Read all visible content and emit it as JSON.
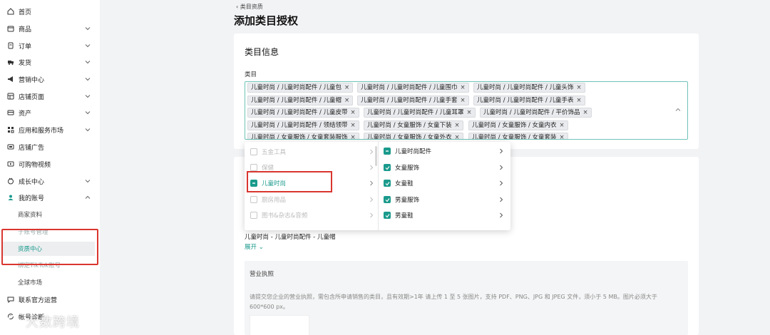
{
  "sidebar": {
    "items": [
      {
        "label": "首页",
        "icon": "home-icon"
      },
      {
        "label": "商品",
        "icon": "product-icon"
      },
      {
        "label": "订单",
        "icon": "order-icon"
      },
      {
        "label": "发货",
        "icon": "truck-icon"
      },
      {
        "label": "营销中心",
        "icon": "megaphone-icon"
      },
      {
        "label": "店铺页面",
        "icon": "store-page-icon"
      },
      {
        "label": "资产",
        "icon": "wallet-icon"
      },
      {
        "label": "应用和服务市场",
        "icon": "apps-icon"
      },
      {
        "label": "店铺广告",
        "icon": "ad-icon"
      },
      {
        "label": "可购物视频",
        "icon": "video-icon"
      },
      {
        "label": "成长中心",
        "icon": "growth-icon"
      },
      {
        "label": "我的账号",
        "icon": "user-icon"
      }
    ],
    "sub_items": [
      "商家资料",
      "子账号管理",
      "资质中心",
      "绑定TikTok账号",
      "全球市场"
    ],
    "bottom_items": [
      {
        "label": "联系官方运营",
        "icon": "chat-icon"
      },
      {
        "label": "帐号诊断",
        "icon": "diagnosis-icon"
      }
    ]
  },
  "breadcrumb": "类目资质",
  "page_title": "添加类目授权",
  "category_card": {
    "heading": "类目信息",
    "field_label": "类目",
    "tags": [
      "儿童时尚 / 儿童时尚配件 / 儿童包",
      "儿童时尚 / 儿童时尚配件 / 儿童围巾",
      "儿童时尚 / 儿童时尚配件 / 儿童头饰",
      "儿童时尚 / 儿童时尚配件 / 儿童帽",
      "儿童时尚 / 儿童时尚配件 / 儿童手套",
      "儿童时尚 / 儿童时尚配件 / 儿童手表",
      "儿童时尚 / 儿童时尚配件 / 儿童皮带",
      "儿童时尚 / 儿童时尚配件 / 儿童耳罩",
      "儿童时尚 / 儿童时尚配件 / 平价饰品",
      "儿童时尚 / 儿童时尚配件 / 领结领带",
      "儿童时尚 / 女童服饰 / 女童下装",
      "儿童时尚 / 女童服饰 / 女童内衣",
      "儿童时尚 / 女童服饰 / 女童套装服饰",
      "儿童时尚 / 女童服饰 / 女童外衣",
      "儿童时尚 / 女童服饰 / 女童套装"
    ]
  },
  "dropdown": {
    "left_options": [
      {
        "label": "五金工具",
        "state": "disabled"
      },
      {
        "label": "保健",
        "state": "disabled"
      },
      {
        "label": "儿童时尚",
        "state": "partial"
      },
      {
        "label": "厨房用品",
        "state": "disabled"
      },
      {
        "label": "图书&杂志&音频",
        "state": "disabled"
      }
    ],
    "right_options": [
      {
        "label": "儿童时尚配件",
        "state": "partial"
      },
      {
        "label": "女童服饰",
        "state": "checked"
      },
      {
        "label": "女童鞋",
        "state": "checked"
      },
      {
        "label": "男童服饰",
        "state": "checked"
      },
      {
        "label": "男童鞋",
        "state": "checked"
      }
    ]
  },
  "selection_summary": "儿童时尚 - 儿童时尚配件 - 儿童帽",
  "expand_label": "展开",
  "license": {
    "title": "营业执照",
    "description": "请提交您企业的营业执照，需包含所申请销售的类目，且有效期>1年 请上传 1 至 5 张图片，支持 PDF、PNG、JPG 和 JPEG 文件，须小于 5 MB。图片必须大于 600*600 px。"
  },
  "watermark": "大数跨境",
  "colors": {
    "accent": "#1a9a8c",
    "highlight": "#d9362f"
  }
}
